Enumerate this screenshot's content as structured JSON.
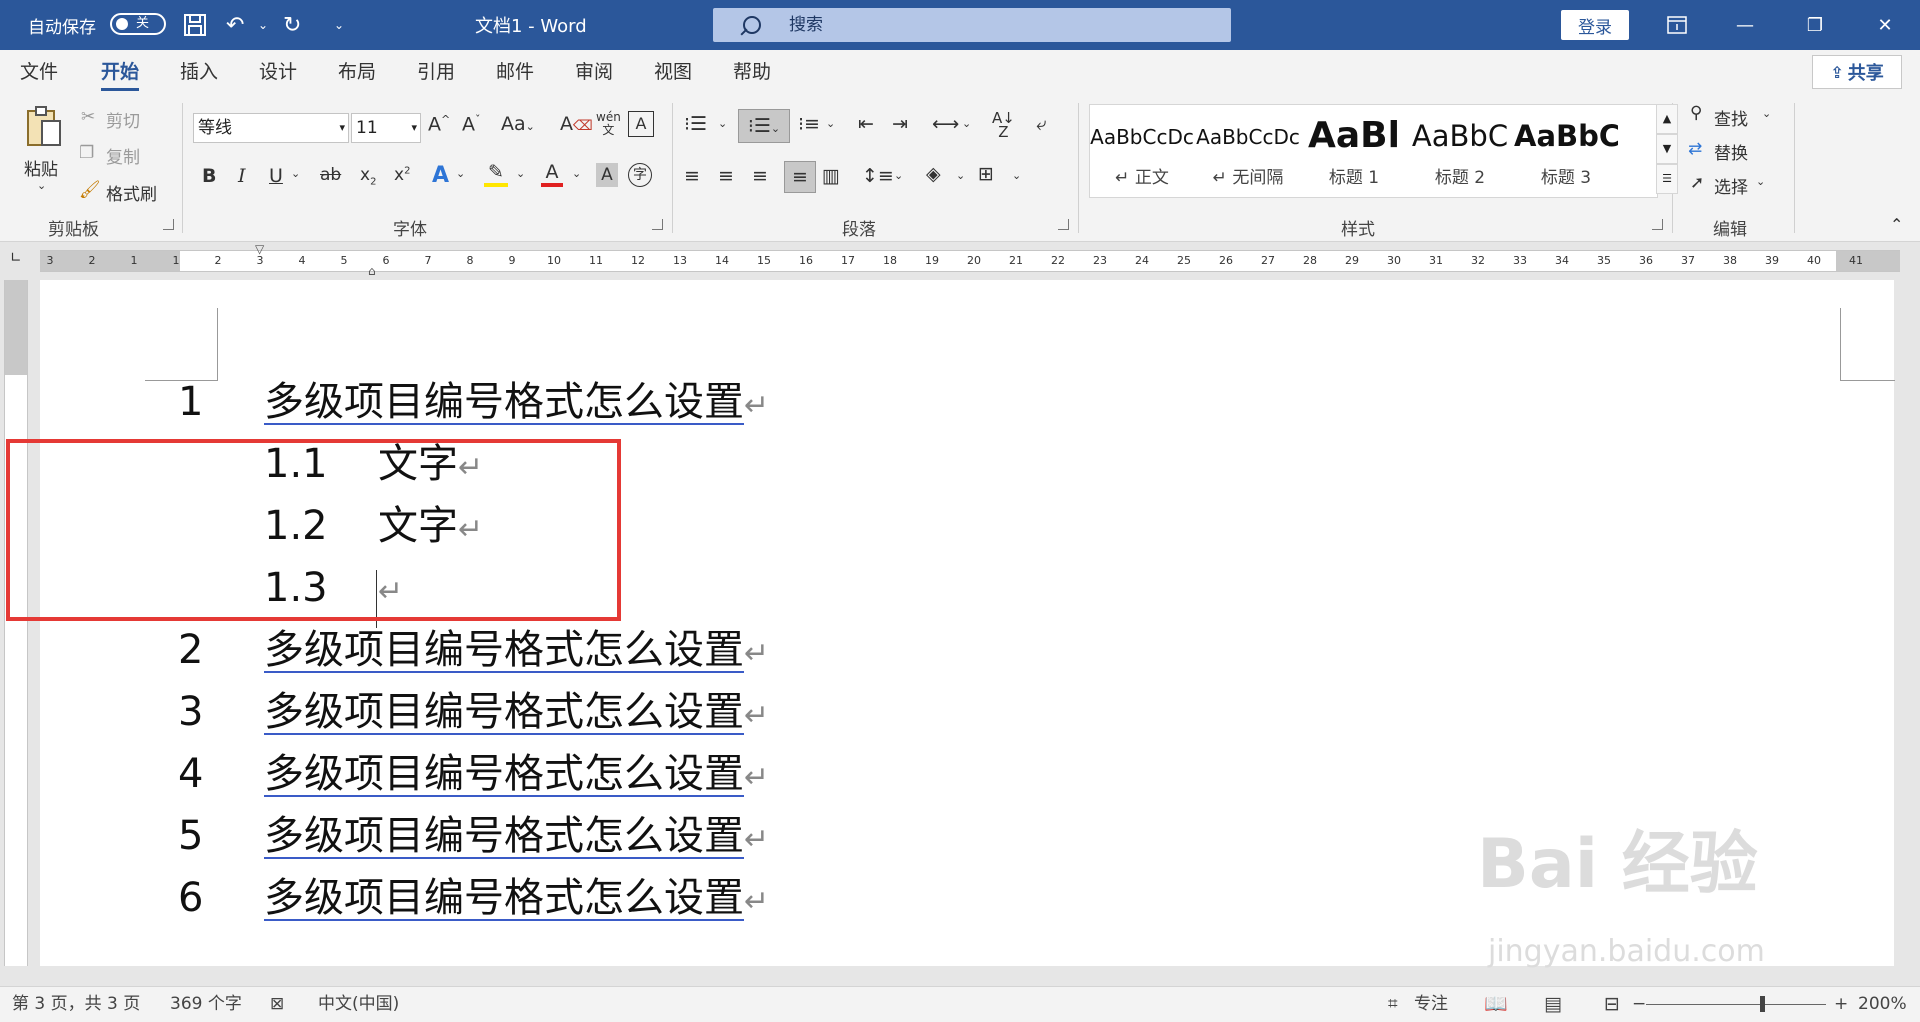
{
  "titlebar": {
    "autosave_label": "自动保存",
    "autosave_state": "关",
    "doc_title": "文档1  -  Word",
    "search_placeholder": "搜索",
    "login_label": "登录",
    "icons": [
      "save-icon",
      "undo-icon",
      "redo-icon",
      "customize-icon",
      "ribbon-display-icon",
      "minimize-icon",
      "restore-icon",
      "close-icon"
    ]
  },
  "tabs": [
    "文件",
    "开始",
    "插入",
    "设计",
    "布局",
    "引用",
    "邮件",
    "审阅",
    "视图",
    "帮助"
  ],
  "active_tab": "开始",
  "share_label": "共享",
  "ribbon": {
    "clipboard": {
      "paste": "粘贴",
      "cut": "剪切",
      "copy": "复制",
      "format_painter": "格式刷",
      "group": "剪贴板"
    },
    "font": {
      "name": "等线",
      "size": "11",
      "group": "字体"
    },
    "paragraph": {
      "group": "段落"
    },
    "styles": {
      "group": "样式",
      "items": [
        {
          "preview": "AaBbCcDc",
          "name": "↵ 正文"
        },
        {
          "preview": "AaBbCcDc",
          "name": "↵ 无间隔"
        },
        {
          "preview": "AaBl",
          "name": "标题 1"
        },
        {
          "preview": "AaBbC",
          "name": "标题 2"
        },
        {
          "preview": "AaBbC",
          "name": "标题 3"
        }
      ]
    },
    "editing": {
      "find": "查找",
      "replace": "替换",
      "select": "选择",
      "group": "编辑"
    }
  },
  "ruler_numbers": [
    "3",
    "2",
    "1",
    "1",
    "2",
    "3",
    "4",
    "5",
    "6",
    "7",
    "8",
    "9",
    "10",
    "11",
    "12",
    "13",
    "14",
    "15",
    "16",
    "17",
    "18",
    "19",
    "20",
    "21",
    "22",
    "23",
    "24",
    "25",
    "26",
    "27",
    "28",
    "29",
    "30",
    "31",
    "32",
    "33",
    "34",
    "35",
    "36",
    "37",
    "38",
    "39",
    "40",
    "41"
  ],
  "document": {
    "paragraphs": [
      {
        "num": "1",
        "text": "多级项目编号格式怎么设置",
        "level": 1
      },
      {
        "num": "1.1",
        "text": "文字",
        "level": 2
      },
      {
        "num": "1.2",
        "text": "文字",
        "level": 2
      },
      {
        "num": "1.3",
        "text": "",
        "level": 2
      },
      {
        "num": "2",
        "text": "多级项目编号格式怎么设置",
        "level": 1
      },
      {
        "num": "3",
        "text": "多级项目编号格式怎么设置",
        "level": 1
      },
      {
        "num": "4",
        "text": "多级项目编号格式怎么设置",
        "level": 1
      },
      {
        "num": "5",
        "text": "多级项目编号格式怎么设置",
        "level": 1
      },
      {
        "num": "6",
        "text": "多级项目编号格式怎么设置",
        "level": 1
      }
    ],
    "paragraph_mark": "↵",
    "highlight_color": "#e53935"
  },
  "watermark": {
    "line1": "Bai 经验",
    "line2": "jingyan.baidu.com"
  },
  "statusbar": {
    "page_info": "第 3 页，共 3 页",
    "word_count": "369 个字",
    "language": "中文(中国)",
    "focus": "专注",
    "zoom": "200%"
  },
  "colors": {
    "brand": "#2b579a",
    "search_bg": "#b4c6e7"
  }
}
